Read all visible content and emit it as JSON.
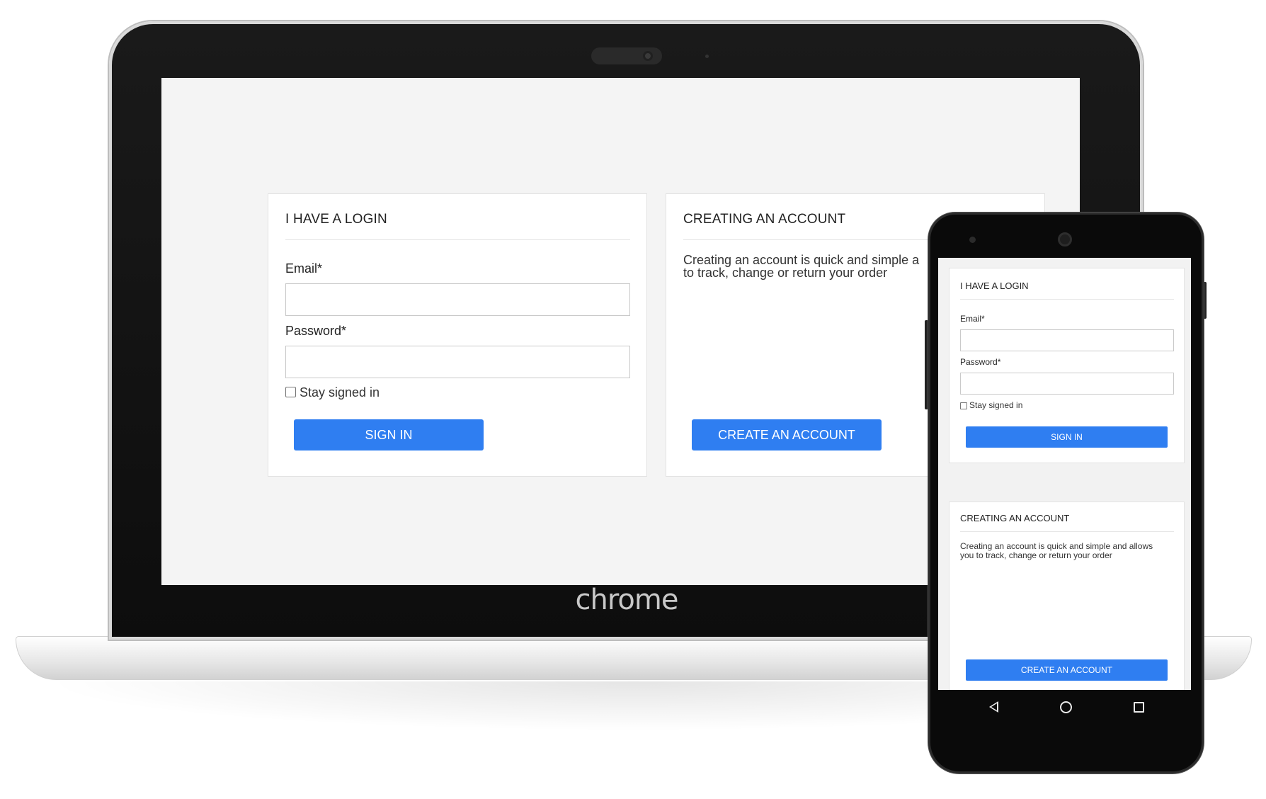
{
  "laptop": {
    "brand": "chrome",
    "login_card": {
      "title": "I HAVE A LOGIN",
      "email_label": "Email*",
      "email_value": "",
      "password_label": "Password*",
      "password_value": "",
      "stay_signed_in_label": "Stay signed in",
      "sign_in_label": "SIGN IN"
    },
    "account_card": {
      "title": "CREATING AN ACCOUNT",
      "description_line1": "Creating an account is quick and simple a",
      "description_line2": "to track, change or return your order",
      "create_label": "CREATE AN ACCOUNT"
    }
  },
  "phone": {
    "login_card": {
      "title": "I HAVE A LOGIN",
      "email_label": "Email*",
      "password_label": "Password*",
      "stay_signed_in_label": "Stay signed in",
      "sign_in_label": "SIGN IN"
    },
    "account_card": {
      "title": "CREATING AN ACCOUNT",
      "description_line1": "Creating an account is quick and simple and allows",
      "description_line2": "you to track, change or return your order",
      "create_label": "CREATE AN ACCOUNT"
    },
    "nav": {
      "back_icon": "back-triangle-icon",
      "home_icon": "home-circle-icon",
      "recents_icon": "recents-square-icon"
    }
  },
  "colors": {
    "primary_button": "#2f7ef1",
    "page_background": "#f4f4f4"
  }
}
